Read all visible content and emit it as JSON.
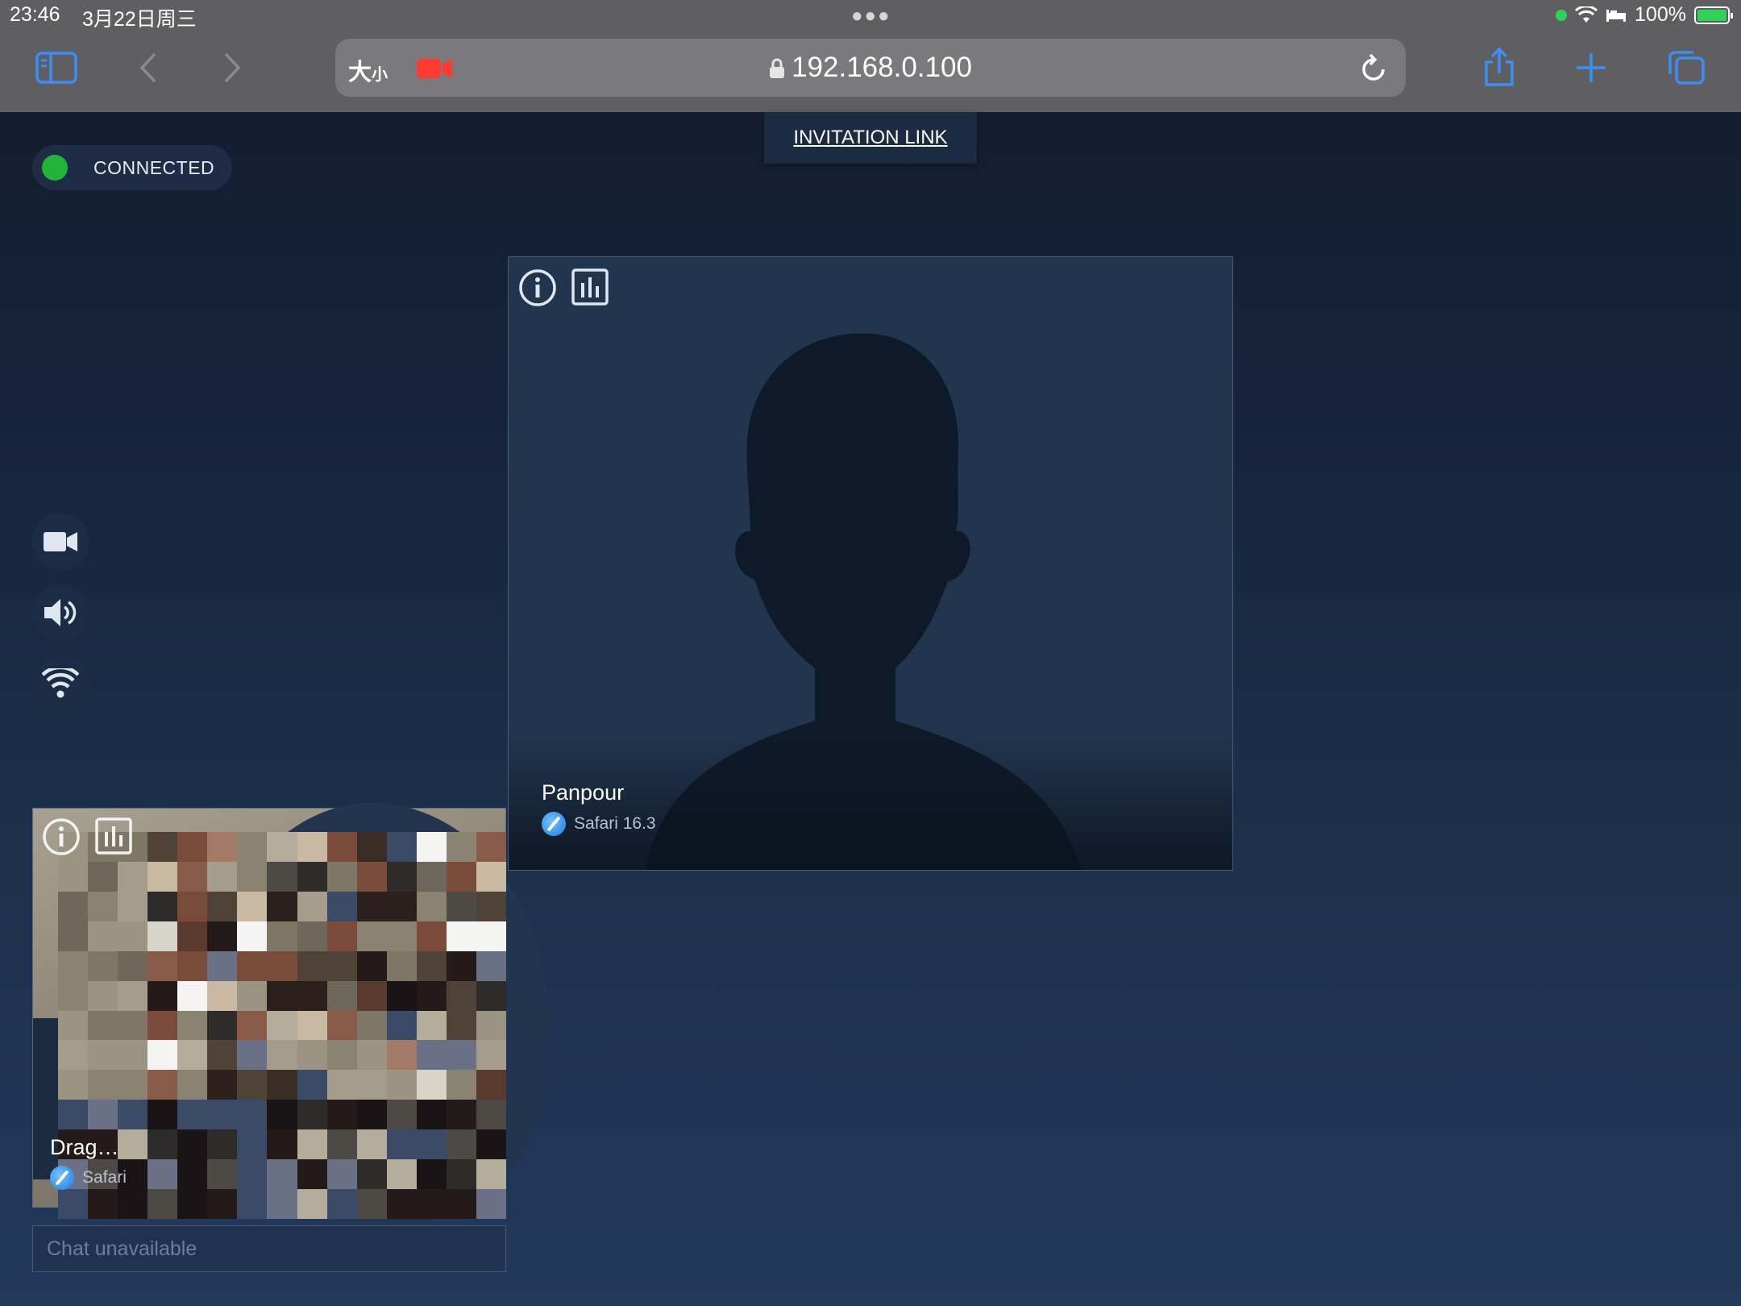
{
  "status_bar": {
    "time": "23:46",
    "date": "3月22日周三",
    "battery": "100%"
  },
  "browser": {
    "text_size_label": "大",
    "text_size_small": "小",
    "url": "192.168.0.100"
  },
  "invitation": {
    "label": "INVITATION LINK"
  },
  "connection": {
    "status": "CONNECTED",
    "color": "#22b33a"
  },
  "side_controls": [
    "camera-icon",
    "speaker-icon",
    "wifi-icon"
  ],
  "participants": [
    {
      "name": "Panpour",
      "browser": "Safari 16.3"
    },
    {
      "name": "Drag…",
      "browser": "Safari"
    }
  ],
  "chat": {
    "placeholder": "Chat unavailable"
  },
  "colors": {
    "accent": "#3a8ef6",
    "background": "#1a2a44",
    "record": "#ff3b30"
  }
}
